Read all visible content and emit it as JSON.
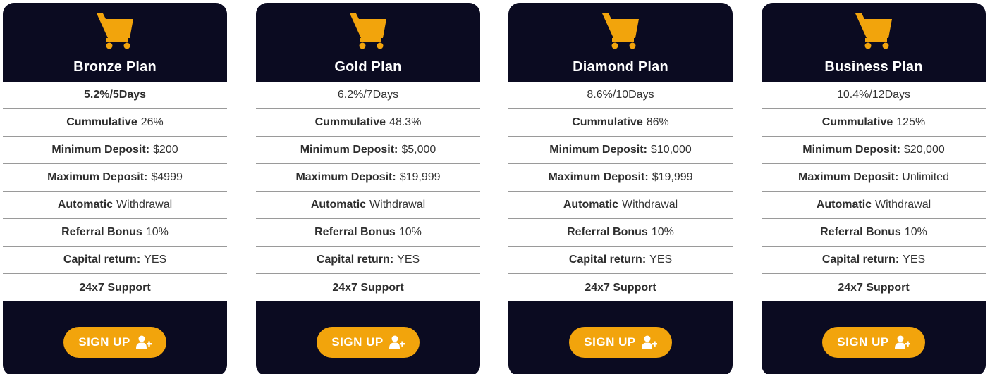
{
  "colors": {
    "card_bg": "#0b0b21",
    "accent": "#f2a40c",
    "text": "#333333"
  },
  "plans": [
    {
      "name": "Bronze Plan",
      "rate": "5.2%/5Days",
      "cumulative_label": "Cummulative",
      "cumulative_value": "26%",
      "min_label": "Minimum Deposit:",
      "min_value": "$200",
      "max_label": "Maximum Deposit:",
      "max_value": "$4999",
      "withdrawal_label": "Automatic",
      "withdrawal_value": "Withdrawal",
      "referral_label": "Referral Bonus",
      "referral_value": "10%",
      "capital_label": "Capital return:",
      "capital_value": "YES",
      "support": "24x7 Support",
      "signup_label": "SIGN UP",
      "icons": {
        "cart": "shopping-cart-icon",
        "signup": "user-plus-icon"
      }
    },
    {
      "name": "Gold Plan",
      "rate": "6.2%/7Days",
      "cumulative_label": "Cummulative",
      "cumulative_value": "48.3%",
      "min_label": "Minimum Deposit:",
      "min_value": "$5,000",
      "max_label": "Maximum Deposit:",
      "max_value": "$19,999",
      "withdrawal_label": "Automatic",
      "withdrawal_value": "Withdrawal",
      "referral_label": "Referral Bonus",
      "referral_value": "10%",
      "capital_label": "Capital return:",
      "capital_value": "YES",
      "support": "24x7 Support",
      "signup_label": "SIGN UP",
      "icons": {
        "cart": "shopping-cart-icon",
        "signup": "user-plus-icon"
      }
    },
    {
      "name": "Diamond Plan",
      "rate": "8.6%/10Days",
      "cumulative_label": "Cummulative",
      "cumulative_value": "86%",
      "min_label": "Minimum Deposit:",
      "min_value": "$10,000",
      "max_label": "Maximum Deposit:",
      "max_value": "$19,999",
      "withdrawal_label": "Automatic",
      "withdrawal_value": "Withdrawal",
      "referral_label": "Referral Bonus",
      "referral_value": "10%",
      "capital_label": "Capital return:",
      "capital_value": "YES",
      "support": "24x7 Support",
      "signup_label": "SIGN UP",
      "icons": {
        "cart": "shopping-cart-icon",
        "signup": "user-plus-icon"
      }
    },
    {
      "name": "Business Plan",
      "rate": "10.4%/12Days",
      "cumulative_label": "Cummulative",
      "cumulative_value": "125%",
      "min_label": "Minimum Deposit:",
      "min_value": "$20,000",
      "max_label": "Maximum Deposit:",
      "max_value": "Unlimited",
      "withdrawal_label": "Automatic",
      "withdrawal_value": "Withdrawal",
      "referral_label": "Referral Bonus",
      "referral_value": "10%",
      "capital_label": "Capital return:",
      "capital_value": "YES",
      "support": "24x7 Support",
      "signup_label": "SIGN UP",
      "icons": {
        "cart": "shopping-cart-icon",
        "signup": "user-plus-icon"
      }
    }
  ]
}
